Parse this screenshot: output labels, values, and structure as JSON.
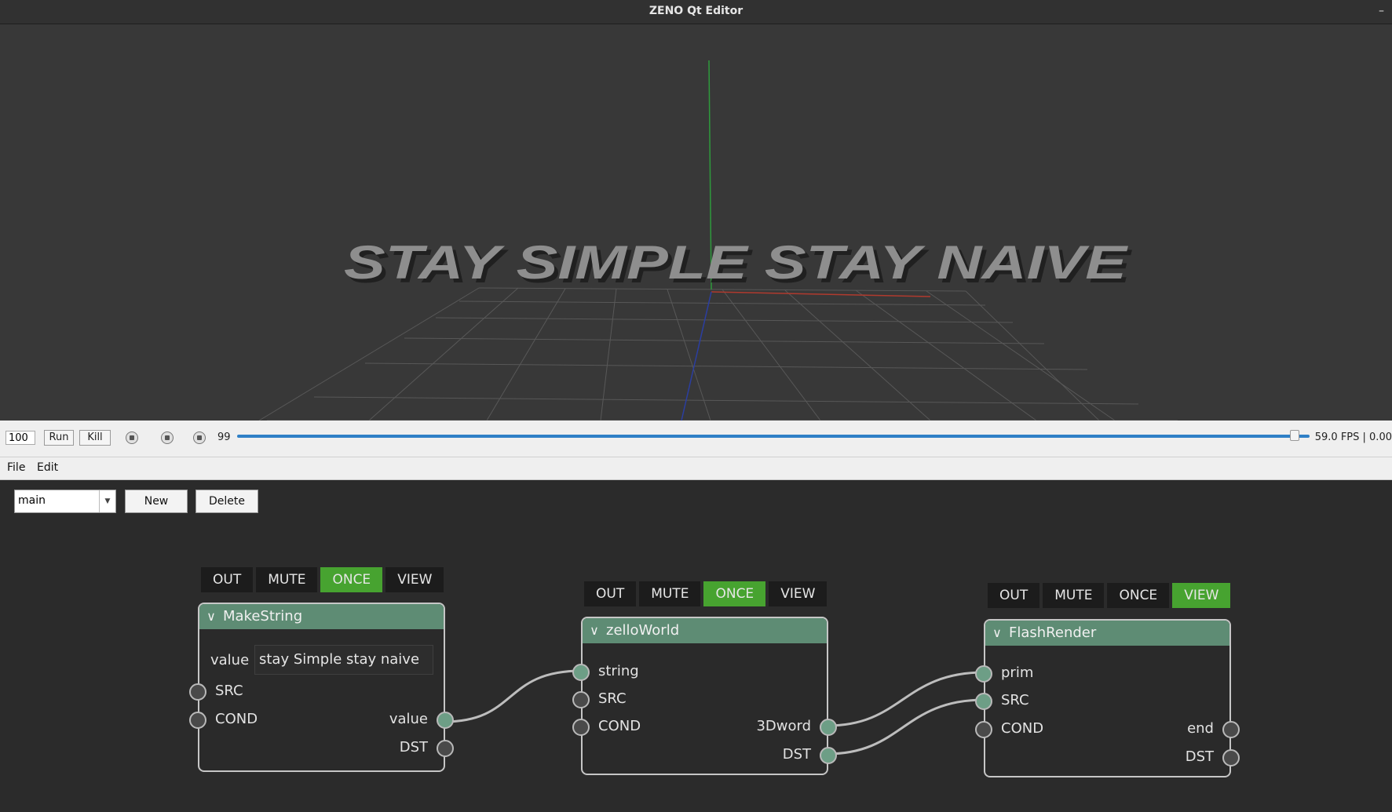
{
  "window": {
    "title": "ZENO Qt Editor",
    "minimize": "–"
  },
  "viewport": {
    "scene_text": "STAY SIMPLE STAY NAIVE",
    "colors": {
      "background": "#383838",
      "grid": "#555555",
      "axis_x": "#b03a2e",
      "axis_y": "#2e9a3c",
      "axis_z": "#2b3ea0"
    }
  },
  "timeline": {
    "frame_count": "100",
    "run_label": "Run",
    "kill_label": "Kill",
    "current_frame": "99",
    "fps_text": "59.0 FPS | 0.00",
    "progress": 0.999
  },
  "menu": {
    "file": "File",
    "edit": "Edit"
  },
  "graph_toolbar": {
    "selected_graph": "main",
    "new_label": "New",
    "delete_label": "Delete"
  },
  "node_buttons": {
    "out": "OUT",
    "mute": "MUTE",
    "once": "ONCE",
    "view": "VIEW"
  },
  "nodes": [
    {
      "title": "MakeString",
      "param_label": "value",
      "param_value": "stay Simple stay naive",
      "inputs": [
        "SRC",
        "COND"
      ],
      "outputs": [
        "value",
        "DST"
      ],
      "active_button": "ONCE"
    },
    {
      "title": "zelloWorld",
      "inputs": [
        "string",
        "SRC",
        "COND"
      ],
      "outputs": [
        "3Dword",
        "DST"
      ],
      "active_button": "ONCE"
    },
    {
      "title": "FlashRender",
      "inputs": [
        "prim",
        "SRC",
        "COND"
      ],
      "outputs": [
        "end",
        "DST"
      ],
      "active_button": "VIEW"
    }
  ],
  "colors": {
    "node_header": "#5e8c74",
    "active_button": "#47a330",
    "socket_connected": "#6d9e86",
    "timeline_accent": "#2f7fc6"
  }
}
